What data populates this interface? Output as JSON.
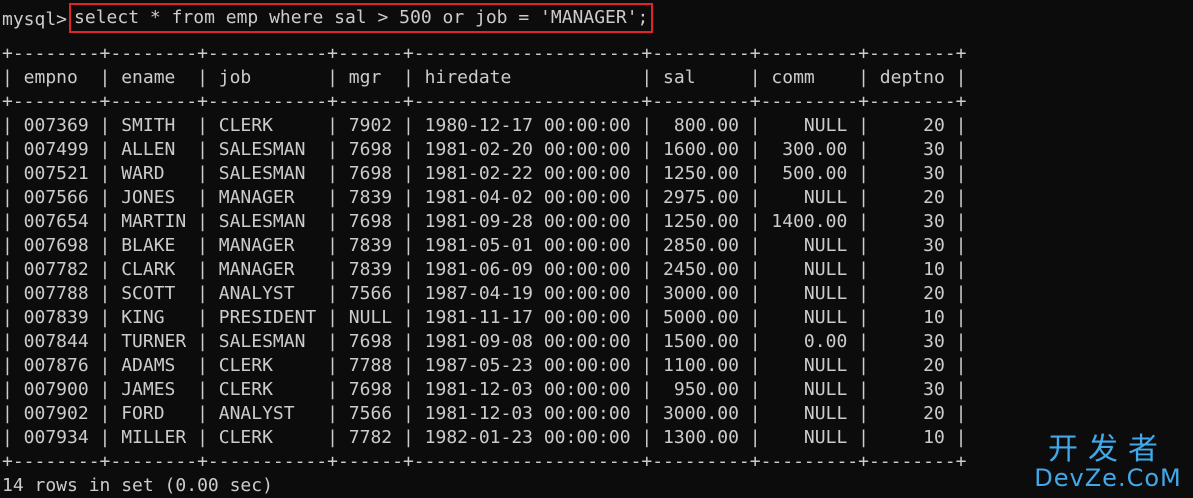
{
  "terminal": {
    "prompt": "mysql>",
    "command": "select * from emp where sal > 500 or job = 'MANAGER';",
    "border_line": "+--------+--------+-----------+------+---------------------+---------+---------+--------+",
    "header_line": "| empno  | ename  | job       | mgr  | hiredate            | sal     | comm    | deptno |",
    "rows": [
      "| 007369 | SMITH  | CLERK     | 7902 | 1980-12-17 00:00:00 |  800.00 |    NULL |     20 |",
      "| 007499 | ALLEN  | SALESMAN  | 7698 | 1981-02-20 00:00:00 | 1600.00 |  300.00 |     30 |",
      "| 007521 | WARD   | SALESMAN  | 7698 | 1981-02-22 00:00:00 | 1250.00 |  500.00 |     30 |",
      "| 007566 | JONES  | MANAGER   | 7839 | 1981-04-02 00:00:00 | 2975.00 |    NULL |     20 |",
      "| 007654 | MARTIN | SALESMAN  | 7698 | 1981-09-28 00:00:00 | 1250.00 | 1400.00 |     30 |",
      "| 007698 | BLAKE  | MANAGER   | 7839 | 1981-05-01 00:00:00 | 2850.00 |    NULL |     30 |",
      "| 007782 | CLARK  | MANAGER   | 7839 | 1981-06-09 00:00:00 | 2450.00 |    NULL |     10 |",
      "| 007788 | SCOTT  | ANALYST   | 7566 | 1987-04-19 00:00:00 | 3000.00 |    NULL |     20 |",
      "| 007839 | KING   | PRESIDENT | NULL | 1981-11-17 00:00:00 | 5000.00 |    NULL |     10 |",
      "| 007844 | TURNER | SALESMAN  | 7698 | 1981-09-08 00:00:00 | 1500.00 |    0.00 |     30 |",
      "| 007876 | ADAMS  | CLERK     | 7788 | 1987-05-23 00:00:00 | 1100.00 |    NULL |     20 |",
      "| 007900 | JAMES  | CLERK     | 7698 | 1981-12-03 00:00:00 |  950.00 |    NULL |     30 |",
      "| 007902 | FORD   | ANALYST   | 7566 | 1981-12-03 00:00:00 | 3000.00 |    NULL |     20 |",
      "| 007934 | MILLER | CLERK     | 7782 | 1982-01-23 00:00:00 | 1300.00 |    NULL |     10 |"
    ],
    "status": "14 rows in set (0.00 sec)"
  },
  "watermark": {
    "top": "开发者",
    "bottom": "DevZe.CoM"
  },
  "colors": {
    "background": "#0c0c0c",
    "text": "#cccccc",
    "highlight_border": "#e0242a",
    "watermark": "#41a8ea"
  }
}
